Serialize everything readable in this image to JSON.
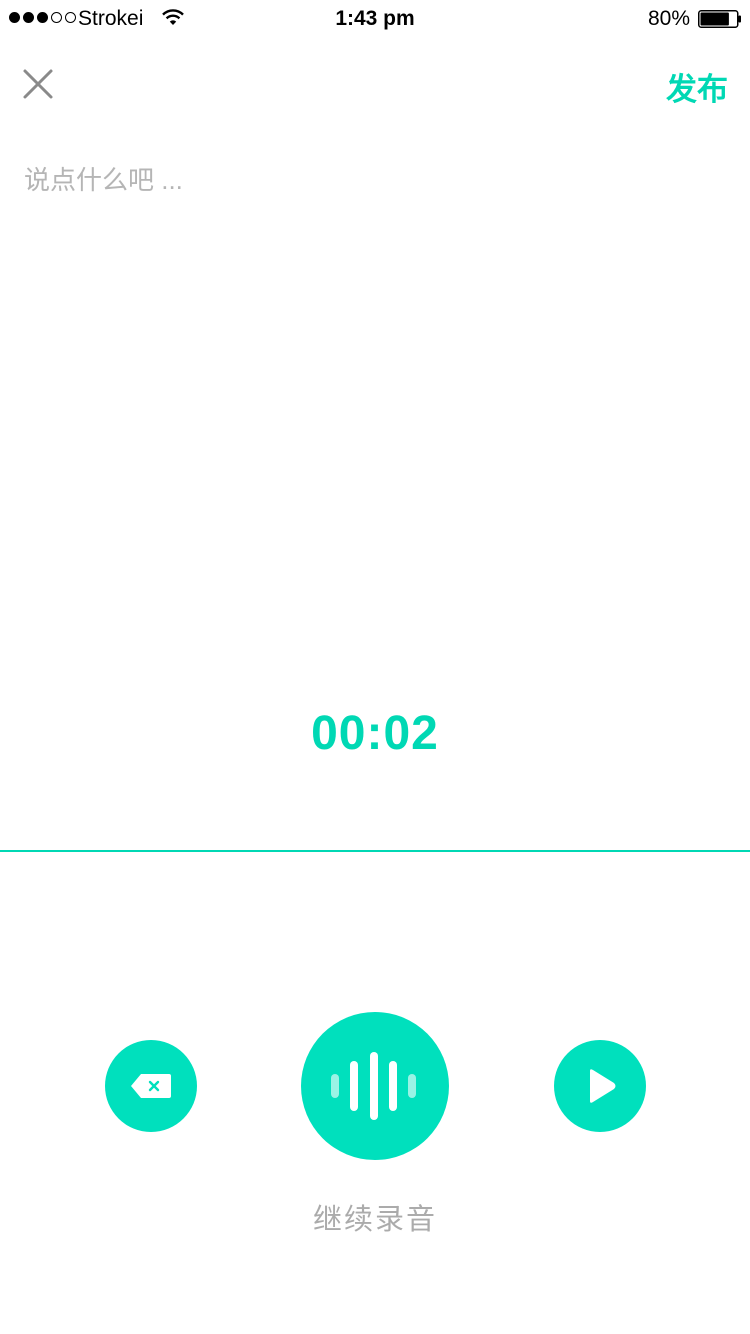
{
  "status_bar": {
    "carrier": "Strokei",
    "time": "1:43 pm",
    "battery_percent": "80%",
    "battery_level": 0.8,
    "signal_strength": 3,
    "signal_max": 5
  },
  "header": {
    "close_icon": "close-icon",
    "publish_label": "发布"
  },
  "composer": {
    "placeholder": "说点什么吧 ...",
    "value": ""
  },
  "recorder": {
    "timer": "00:02",
    "action_label": "继续录音",
    "delete_icon": "backspace-icon",
    "record_icon": "waveform-icon",
    "play_icon": "play-icon"
  },
  "colors": {
    "accent": "#00e0bd",
    "accent_text": "#00d8b4",
    "placeholder": "#b5b5b5",
    "label": "#ababab"
  }
}
